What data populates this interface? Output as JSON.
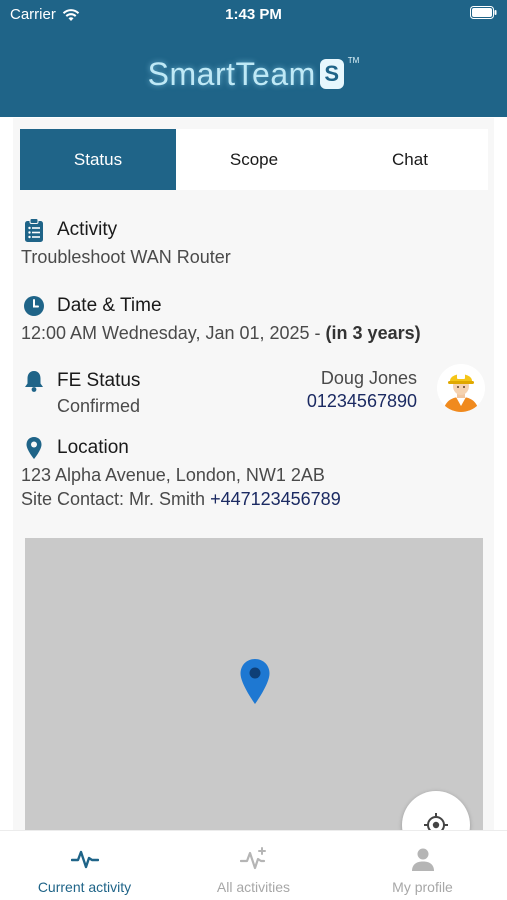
{
  "status_bar": {
    "carrier": "Carrier",
    "time": "1:43 PM"
  },
  "header": {
    "logo_text": "SmartTeam",
    "logo_mark": "S",
    "logo_tm": "TM",
    "color": "#1f6488"
  },
  "tabs": [
    {
      "label": "Status",
      "active": true
    },
    {
      "label": "Scope",
      "active": false
    },
    {
      "label": "Chat",
      "active": false
    }
  ],
  "activity": {
    "title": "Activity",
    "value": "Troubleshoot WAN Router",
    "icon": "clipboard-list-icon"
  },
  "datetime": {
    "title": "Date & Time",
    "value": "12:00 AM Wednesday, Jan 01, 2025 - ",
    "paren_open": "(",
    "relative": "in 3 years",
    "paren_close": ")",
    "icon": "clock-icon"
  },
  "fe_status": {
    "title": "FE Status",
    "value": "Confirmed",
    "engineer_name": "Doug Jones",
    "engineer_phone": "01234567890",
    "icon": "bell-icon",
    "avatar": "engineer-avatar"
  },
  "location": {
    "title": "Location",
    "address": "123 Alpha Avenue, London, NW1 2AB",
    "site_contact_label": "Site Contact: Mr. Smith ",
    "site_contact_phone": "+447123456789",
    "icon": "map-pin-icon"
  },
  "map": {
    "pin_color": "#1e78d2",
    "locate_icon": "crosshair-icon"
  },
  "bottom_nav": [
    {
      "label": "Current activity",
      "icon": "activity-pulse-icon",
      "active": true
    },
    {
      "label": "All activities",
      "icon": "activity-sparkle-icon",
      "active": false
    },
    {
      "label": "My profile",
      "icon": "person-icon",
      "active": false
    }
  ]
}
